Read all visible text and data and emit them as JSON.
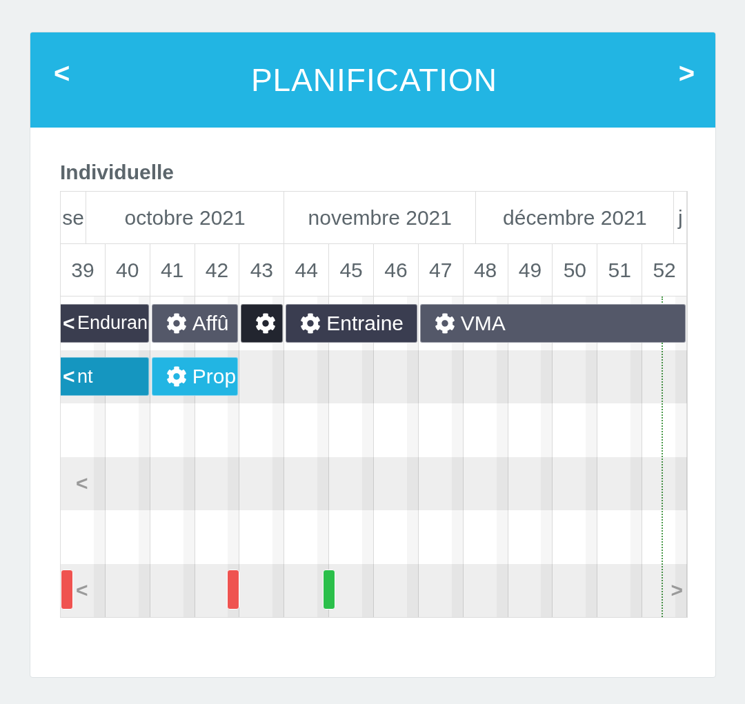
{
  "header": {
    "title": "PLANIFICATION",
    "prev": "<",
    "next": ">"
  },
  "section_title": "Individuelle",
  "months": [
    "se",
    "octobre 2021",
    "novembre 2021",
    "décembre 2021",
    "j"
  ],
  "weeks": [
    "39",
    "40",
    "41",
    "42",
    "43",
    "44",
    "45",
    "46",
    "47",
    "48",
    "49",
    "50",
    "51",
    "52"
  ],
  "rows": [
    {
      "scroll_left": "<",
      "bars": [
        {
          "label": "Enduran",
          "gear": false,
          "color": "#3a3d4f"
        },
        {
          "label": "Affû",
          "gear": true,
          "color": "#545869"
        },
        {
          "gear": true,
          "color": "#22252f"
        },
        {
          "label": "Entraine",
          "gear": true,
          "color": "#3a3d50"
        },
        {
          "label": "VMA",
          "gear": true,
          "color": "#545869"
        }
      ]
    },
    {
      "scroll_left": "<",
      "bars": [
        {
          "label": "nt",
          "gear": false,
          "color": "#1596c0"
        },
        {
          "label": "Prop",
          "gear": true,
          "color": "#22b5e3"
        }
      ]
    },
    {},
    {
      "scroll_left": "<"
    },
    {},
    {
      "scroll_left": "<",
      "scroll_right": ">",
      "markers": [
        {
          "color": "#ef5350"
        },
        {
          "color": "#ef5350"
        },
        {
          "color": "#2bbf4a"
        }
      ]
    }
  ]
}
